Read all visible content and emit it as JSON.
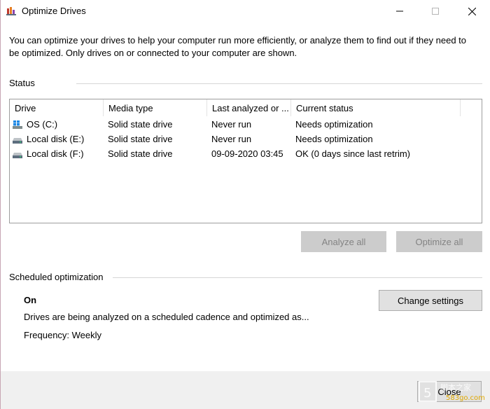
{
  "window": {
    "title": "Optimize Drives",
    "app_icon": "optimize-drives-icon",
    "controls": {
      "minimize": "—",
      "maximize": "☐",
      "close": "✕"
    }
  },
  "intro_text": "You can optimize your drives to help your computer run more efficiently, or analyze them to find out if they need to be optimized. Only drives on or connected to your computer are shown.",
  "status": {
    "label": "Status",
    "columns": [
      "Drive",
      "Media type",
      "Last analyzed or ...",
      "Current status"
    ],
    "drives": [
      {
        "icon": "windows-drive-icon",
        "name": "OS (C:)",
        "media_type": "Solid state drive",
        "last_analyzed": "Never run",
        "current_status": "Needs optimization"
      },
      {
        "icon": "disk-drive-icon",
        "name": "Local disk (E:)",
        "media_type": "Solid state drive",
        "last_analyzed": "Never run",
        "current_status": "Needs optimization"
      },
      {
        "icon": "disk-drive-icon",
        "name": "Local disk (F:)",
        "media_type": "Solid state drive",
        "last_analyzed": "09-09-2020 03:45",
        "current_status": "OK (0 days since last retrim)"
      }
    ],
    "analyze_all_label": "Analyze all",
    "optimize_all_label": "Optimize all"
  },
  "scheduled": {
    "label": "Scheduled optimization",
    "state": "On",
    "description": "Drives are being analyzed on a scheduled cadence and optimized as...",
    "frequency": "Frequency: Weekly",
    "change_settings_label": "Change settings"
  },
  "footer": {
    "close_label": "Close"
  },
  "watermark": {
    "text_top": "脚本之家",
    "text_bottom": "583go.com"
  },
  "colors": {
    "disabled_button": "#cccccc",
    "disabled_text": "#838383",
    "button_face": "#e1e1e1",
    "footer_bg": "#f0f0f0",
    "window_border": "#c7a6b4"
  }
}
